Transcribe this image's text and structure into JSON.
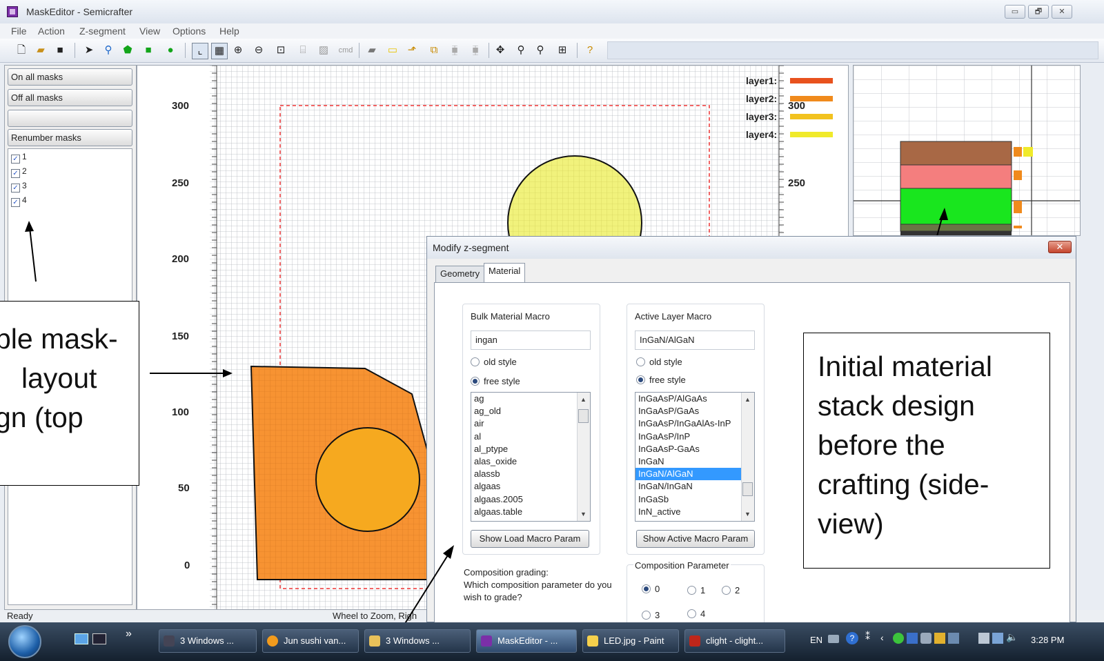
{
  "window": {
    "title": "MaskEditor - Semicrafter",
    "controls": [
      "▭",
      "🗗",
      "✕"
    ]
  },
  "menu": [
    "File",
    "Action",
    "Z-segment",
    "View",
    "Options",
    "Help"
  ],
  "toolbar": {
    "cmd_label": "cmd"
  },
  "left_panel": {
    "buttons": [
      "On all masks",
      "Off all masks",
      "",
      "Renumber masks"
    ],
    "masks": [
      {
        "label": "1",
        "checked": "✓"
      },
      {
        "label": "2",
        "checked": "✓"
      },
      {
        "label": "3",
        "checked": "✓"
      },
      {
        "label": "4",
        "checked": "✓"
      }
    ]
  },
  "canvas": {
    "y_ticks": [
      "300",
      "250",
      "200",
      "150",
      "100",
      "50",
      "0"
    ],
    "legend": [
      {
        "label": "layer1:",
        "color": "#e8521e"
      },
      {
        "label": "layer2:",
        "color": "#f08a1c"
      },
      {
        "label": "layer3:",
        "color": "#f2c21f"
      },
      {
        "label": "layer4:",
        "color": "#f0ea2a"
      }
    ],
    "right_ticks": [
      "300",
      "250"
    ]
  },
  "side_view": {
    "stack_colors": [
      "#a86845",
      "#f47e7e",
      "#19e61e",
      "#6b7545",
      "#333333"
    ],
    "marker_color": "#f08a1c",
    "marker_color_alt": "#f0ea2a"
  },
  "status": {
    "left": "Ready",
    "mid": "Wheel to Zoom, Righ"
  },
  "dialog": {
    "title": "Modify z-segment",
    "close": "✕",
    "tabs": [
      "Geometry",
      "Material"
    ],
    "bulk": {
      "title": "Bulk Material Macro",
      "value": "ingan",
      "radio_old": "old style",
      "radio_free": "free style",
      "items": [
        "ag",
        "ag_old",
        "air",
        "al",
        "al_ptype",
        "alas_oxide",
        "alassb",
        "algaas",
        "algaas.2005",
        "algaas.table"
      ],
      "button": "Show Load Macro Param"
    },
    "active": {
      "title": "Active Layer Macro",
      "value": "InGaN/AlGaN",
      "radio_old": "old style",
      "radio_free": "free style",
      "items": [
        "InGaAsP/AlGaAs",
        "InGaAsP/GaAs",
        "InGaAsP/InGaAlAs-InP",
        "InGaAsP/InP",
        "InGaAsP-GaAs",
        "InGaN",
        "InGaN/AlGaN",
        "InGaN/InGaN",
        "InGaSb",
        "InN_active"
      ],
      "selected": "InGaN/AlGaN",
      "button": "Show Active Macro Param"
    },
    "grading": {
      "line1": "Composition grading:",
      "line2": "Which composition parameter do you",
      "line3": "wish to grade?"
    },
    "composition": {
      "title": "Composition Parameter",
      "options": [
        "0",
        "1",
        "2",
        "3",
        "4"
      ],
      "selected": "0"
    }
  },
  "annotations": {
    "left_note": [
      "ple mask-",
      "layout",
      "gn (top"
    ],
    "right_note": [
      "Initial material",
      "stack design",
      "before the",
      "crafting (side-",
      "view)"
    ]
  },
  "taskbar": {
    "items": [
      "3 Windows ...",
      "Jun sushi van...",
      "3 Windows ...",
      "MaskEditor - ...",
      "LED.jpg - Paint",
      "clight - clight..."
    ],
    "lang": "EN",
    "clock": "3:28 PM"
  }
}
